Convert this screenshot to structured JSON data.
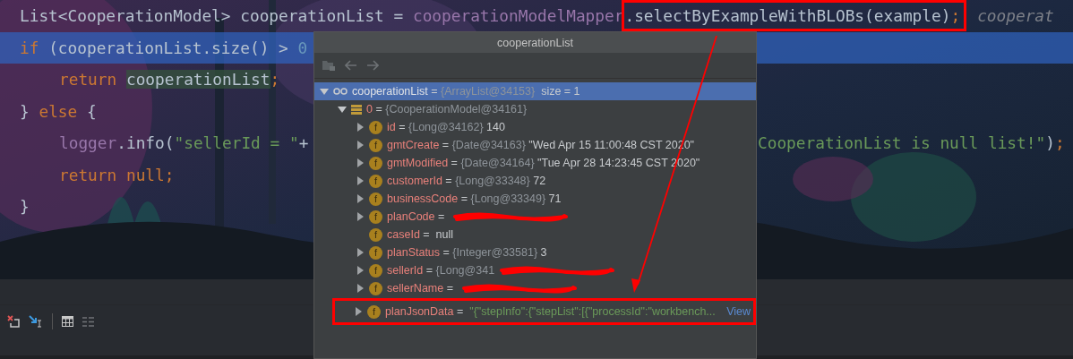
{
  "editor": {
    "lines": [
      {
        "current": false,
        "tokens": [
          {
            "kind": "plain",
            "text": "List<CooperationModel> cooperationList = "
          },
          {
            "kind": "field",
            "text": "cooperationModelMapper"
          }
        ],
        "framed_tokens": [
          {
            "kind": "plain",
            "text": ".selectByExampleWithBLOBs(example)"
          },
          {
            "kind": "punct",
            "text": ";"
          }
        ],
        "hint": "cooperat"
      },
      {
        "current": true,
        "tokens": [
          {
            "kind": "keyword",
            "text": "if"
          },
          {
            "kind": "plain",
            "text": " (cooperationList.size() > "
          },
          {
            "kind": "number",
            "text": "0"
          }
        ],
        "children": [
          {
            "current": false,
            "tokens": [
              {
                "kind": "keyword",
                "text": "return "
              },
              {
                "kind": "usage",
                "text": "cooperationList"
              },
              {
                "kind": "punct",
                "text": ";"
              }
            ]
          }
        ]
      },
      {
        "current": false,
        "tokens": [
          {
            "kind": "plain",
            "text": "} "
          },
          {
            "kind": "keyword",
            "text": "else"
          },
          {
            "kind": "plain",
            "text": " {"
          }
        ],
        "children": [
          {
            "current": false,
            "tokens": [
              {
                "kind": "field",
                "text": "logger"
              },
              {
                "kind": "plain",
                "text": ".info("
              },
              {
                "kind": "string",
                "text": "\"sellerId = \""
              },
              {
                "kind": "plain",
                "text": "+"
              }
            ],
            "tail_tokens": [
              {
                "kind": "string",
                "text": "CooperationList is null list!\""
              },
              {
                "kind": "plain",
                "text": ")"
              },
              {
                "kind": "punct",
                "text": ";"
              }
            ]
          },
          {
            "current": false,
            "tokens": [
              {
                "kind": "keyword",
                "text": "return null"
              },
              {
                "kind": "punct",
                "text": ";"
              }
            ]
          }
        ]
      },
      {
        "current": false,
        "tokens": [
          {
            "kind": "plain",
            "text": "}"
          }
        ]
      }
    ]
  },
  "popup": {
    "title": "cooperationList",
    "toolbar": [
      {
        "kind": "folder"
      },
      {
        "kind": "back"
      },
      {
        "kind": "forward"
      }
    ],
    "tree": [
      {
        "kind": "watch",
        "name": "cooperationList",
        "op": "=",
        "type": "{ArrayList@34153}",
        "extra": "size = 1",
        "expandable": true,
        "expanded": true,
        "selected": true,
        "framed": false,
        "children": [
          {
            "kind": "object",
            "name": "0",
            "op": "=",
            "type": "{CooperationModel@34161}",
            "expandable": true,
            "expanded": true,
            "selected": false,
            "framed": false,
            "children": [
              {
                "kind": "field",
                "badge": "f",
                "name": "id",
                "op": "=",
                "type": "{Long@34162}",
                "value": "140",
                "expandable": true,
                "expanded": false,
                "selected": false,
                "framed": false
              },
              {
                "kind": "field",
                "badge": "f",
                "name": "gmtCreate",
                "op": "=",
                "type": "{Date@34163}",
                "value": "\"Wed Apr 15 11:00:48 CST 2020\"",
                "expandable": true,
                "expanded": false,
                "selected": false,
                "framed": false
              },
              {
                "kind": "field",
                "badge": "f",
                "name": "gmtModified",
                "op": "=",
                "type": "{Date@34164}",
                "value": "\"Tue Apr 28 14:23:45 CST 2020\"",
                "expandable": true,
                "expanded": false,
                "selected": false,
                "framed": false
              },
              {
                "kind": "field",
                "badge": "f",
                "name": "customerId",
                "op": "=",
                "type": "{Long@33348}",
                "value": "72",
                "expandable": true,
                "expanded": false,
                "selected": false,
                "framed": false
              },
              {
                "kind": "field",
                "badge": "f",
                "name": "businessCode",
                "op": "=",
                "type": "{Long@33349}",
                "value": "71",
                "expandable": true,
                "expanded": false,
                "selected": false,
                "framed": false
              },
              {
                "kind": "field",
                "badge": "f",
                "name": "planCode",
                "op": "=",
                "redacted": true,
                "expandable": true,
                "expanded": false,
                "selected": false,
                "framed": false
              },
              {
                "kind": "field",
                "badge": "f",
                "name": "caseId",
                "op": "=",
                "value": "null",
                "expandable": false,
                "expanded": false,
                "selected": false,
                "framed": false
              },
              {
                "kind": "field",
                "badge": "f",
                "name": "planStatus",
                "op": "=",
                "type": "{Integer@33581}",
                "value": "3",
                "expandable": true,
                "expanded": false,
                "selected": false,
                "framed": false
              },
              {
                "kind": "field",
                "badge": "f",
                "name": "sellerId",
                "op": "=",
                "type": "{Long@341",
                "redacted": true,
                "expandable": true,
                "expanded": false,
                "selected": false,
                "framed": false
              },
              {
                "kind": "field",
                "badge": "f",
                "name": "sellerName",
                "op": "=",
                "redacted": true,
                "expandable": true,
                "expanded": false,
                "selected": false,
                "framed": false
              },
              {
                "kind": "string_field",
                "badge": "f",
                "name": "planJsonData",
                "op": "=",
                "value": "\"{\"stepInfo\":{\"stepList\":[{\"processId\":\"workbench...",
                "link": "View",
                "expandable": true,
                "expanded": false,
                "selected": false,
                "framed": true
              }
            ]
          }
        ]
      }
    ]
  },
  "debug_toolbar": [
    {
      "kind": "remove"
    },
    {
      "kind": "jump"
    },
    {
      "kind": "table"
    },
    {
      "kind": "list"
    }
  ]
}
